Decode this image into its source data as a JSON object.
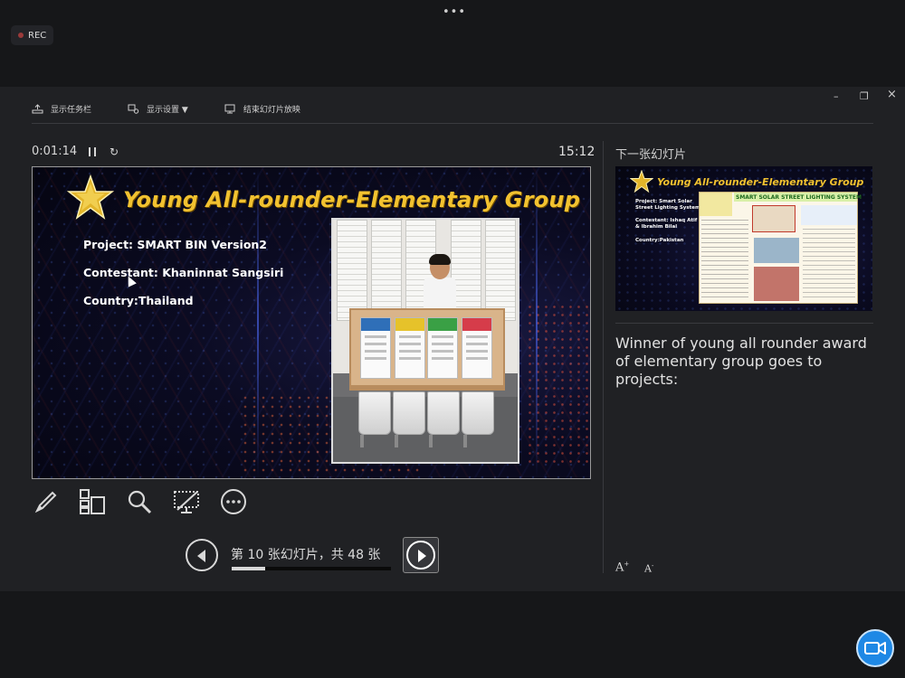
{
  "top_bar": {
    "more_label": "•••",
    "rec_label": "REC"
  },
  "window_controls": {
    "minimize": "–",
    "restore": "❐",
    "close": "×"
  },
  "toolbar": {
    "show_taskbar": "显示任务栏",
    "display_settings": "显示设置 ▼",
    "end_show": "结束幻灯片放映"
  },
  "timer": {
    "elapsed": "0:01:14",
    "reset_glyph": "↻"
  },
  "clock": "15:12",
  "current_slide": {
    "title": "Young All-rounder-Elementary Group",
    "project": "Project:  SMART BIN Version2",
    "contestant": "Contestant: Khaninnat Sangsiri",
    "country": "Country:Thailand"
  },
  "navigation": {
    "label": "第 10 张幻灯片，共 48 张",
    "current": 10,
    "total": 48
  },
  "next_slide": {
    "heading": "下一张幻灯片",
    "title": "Young All-rounder-Elementary Group",
    "project": "Project:   Smart Solar Street Lighting System",
    "contestant": "Contestant: Ishaq Atif & Ibrahim Bilal",
    "country": "Country:Pakistan",
    "poster_title": "SMART SOLAR STREET LIGHTING SYSTEM"
  },
  "notes": "Winner of young all rounder award of elementary group goes to projects:",
  "font_controls": {
    "increase": "A",
    "decrease": "A"
  },
  "colors": {
    "accent_gold": "#f2c230",
    "camera_blue": "#1e88e5",
    "panel_bg": "#202124"
  }
}
